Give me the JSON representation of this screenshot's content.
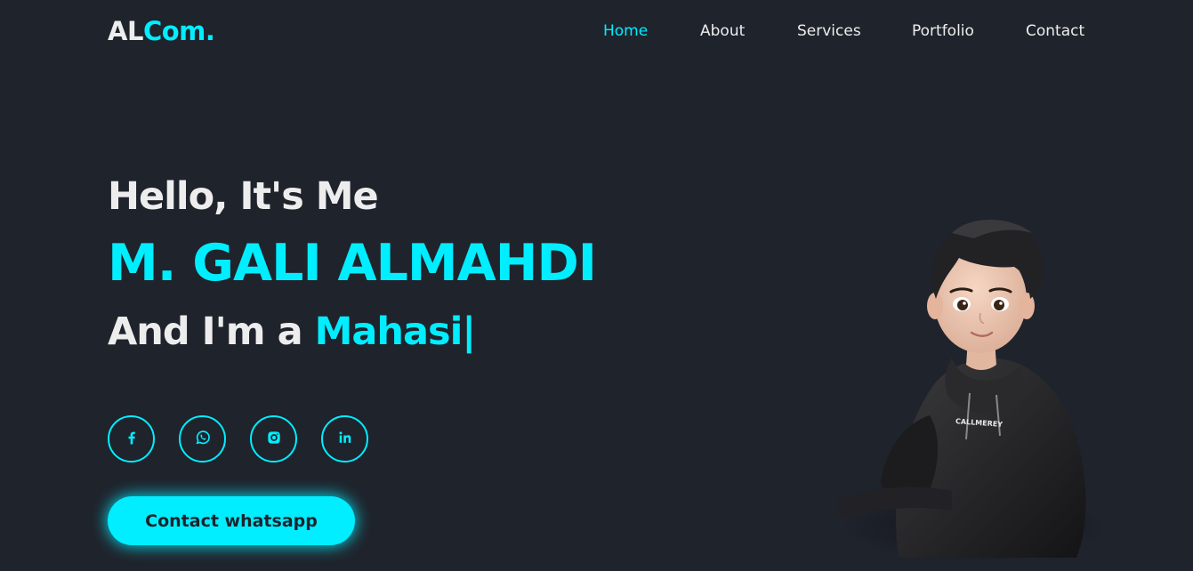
{
  "header": {
    "logo_main": "AL",
    "logo_accent": "Com.",
    "nav": [
      "Home",
      "About",
      "Services",
      "Portfolio",
      "Contact"
    ]
  },
  "home": {
    "greeting": "Hello, It's Me",
    "name": "M. GALI ALMAHDI",
    "role_prefix": "And I'm a ",
    "role_typed": "Mahasi",
    "caret": "|"
  },
  "socials": [
    {
      "icon": "facebook-icon"
    },
    {
      "icon": "whatsapp-icon"
    },
    {
      "icon": "instagram-icon"
    },
    {
      "icon": "linkedin-icon"
    }
  ],
  "cta": {
    "label": "Contact whatsapp"
  },
  "avatar": {
    "hoodie_text": "CALLMEREY"
  },
  "colors": {
    "background": "#1f232c",
    "accent": "#00eeff",
    "text": "#ededed"
  }
}
